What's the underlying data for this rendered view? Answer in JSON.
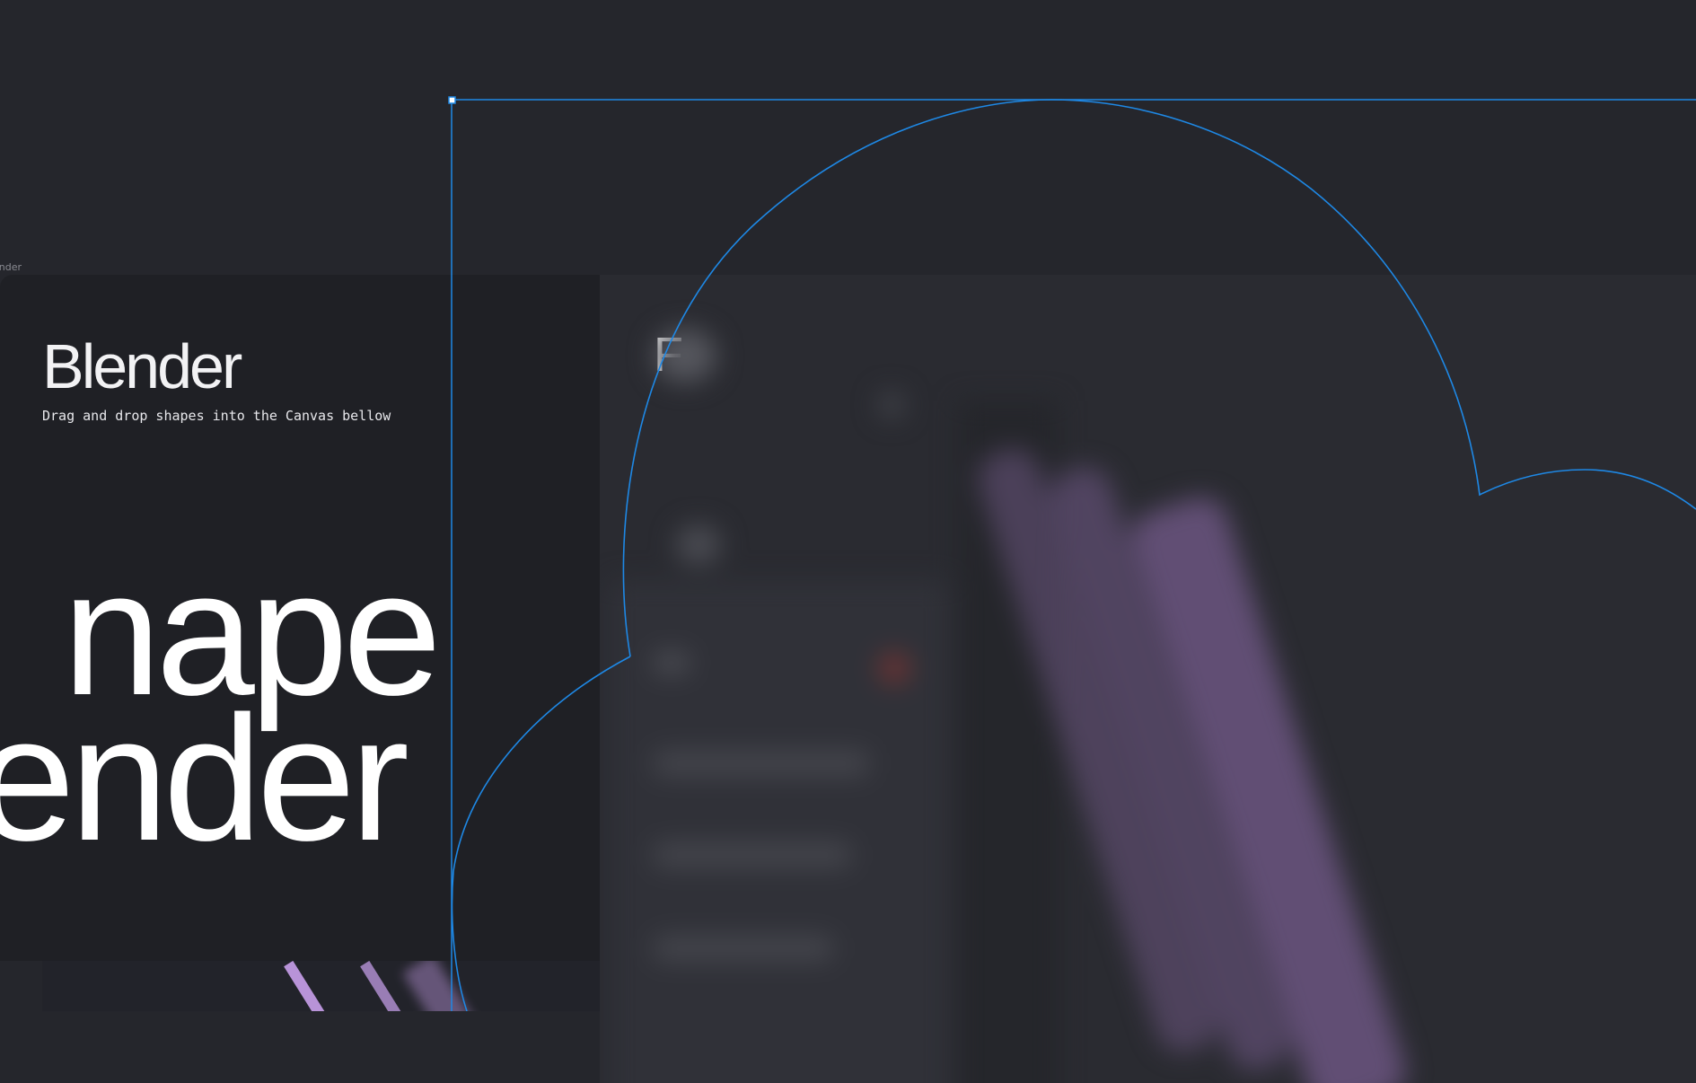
{
  "frame": {
    "label": "ender"
  },
  "left_panel": {
    "title": "Blender",
    "subtitle": "Drag and drop shapes into the Canvas bellow",
    "big_line_1": "nape",
    "big_line_2": "ender"
  },
  "right_panel": {
    "heading": "F"
  },
  "colors": {
    "background": "#25262c",
    "panel": "#1f2025",
    "selection": "#1e88e5",
    "accent_purple": "#6b5580"
  }
}
